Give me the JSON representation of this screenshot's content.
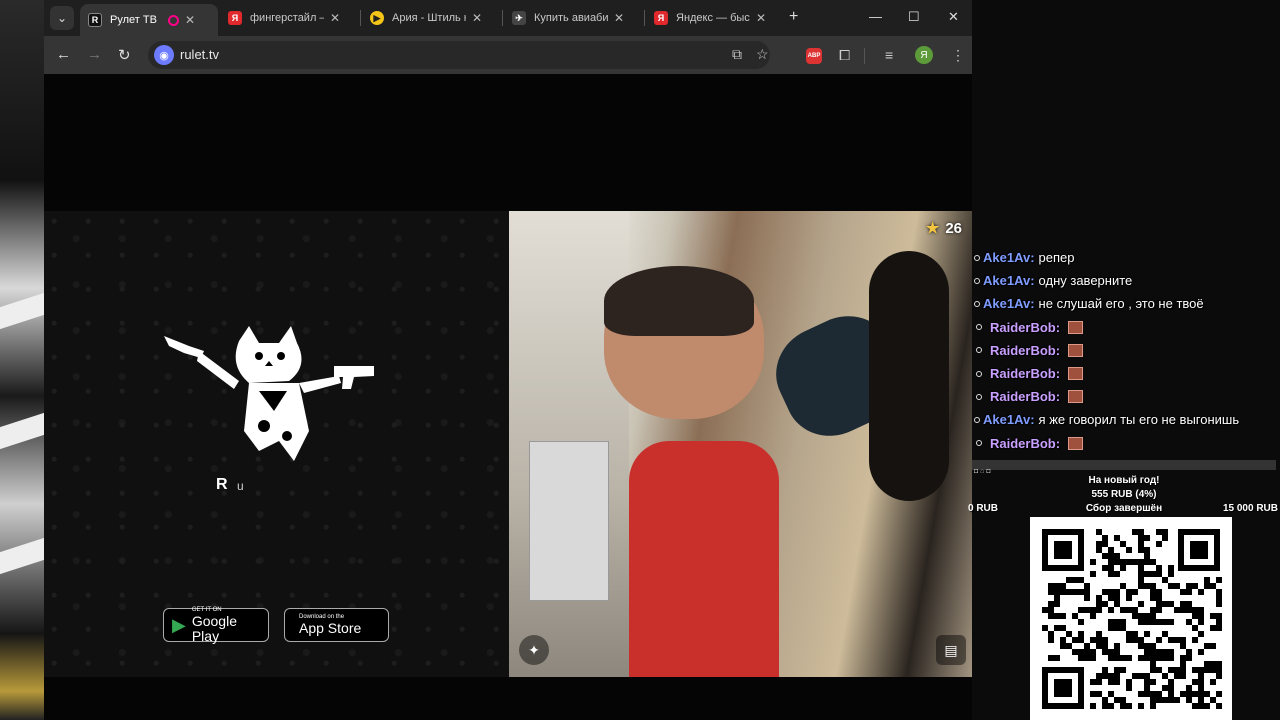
{
  "browser": {
    "tabs": [
      {
        "title": "Рулет ТВ",
        "favicon": "R",
        "favicon_color": "#111111",
        "active": true,
        "recording": true
      },
      {
        "title": "фингерстайл — Я",
        "favicon": "Я",
        "favicon_color": "#e0282d",
        "active": false
      },
      {
        "title": "Ария - Штиль на",
        "favicon": "▶",
        "favicon_color": "#f5c518",
        "active": false
      },
      {
        "title": "Купить авиабилет",
        "favicon": "✈",
        "favicon_color": "#444444",
        "active": false
      },
      {
        "title": "Яндекс — быстро",
        "favicon": "Я",
        "favicon_color": "#e0282d",
        "active": false
      }
    ],
    "url": "rulet.tv",
    "extension_abp": "ABP",
    "profile_initial": "Я"
  },
  "page": {
    "brand_letter": "R",
    "brand_rest": "u",
    "google_play": {
      "small": "GET IT ON",
      "big": "Google Play"
    },
    "app_store": {
      "small": "Download on the",
      "big": "App Store"
    },
    "star_count": "26"
  },
  "chat": {
    "messages": [
      {
        "user": "Ake1Av:",
        "text": "репер",
        "color": "#7f9cff",
        "emote": false
      },
      {
        "user": "Ake1Av:",
        "text": "одну заверните",
        "color": "#7f9cff",
        "emote": false
      },
      {
        "user": "Ake1Av:",
        "text": "не слушай его , это не твоё",
        "color": "#7f9cff",
        "emote": false
      },
      {
        "user": "RaiderBob:",
        "text": "",
        "color": "#c9a0ff",
        "emote": true
      },
      {
        "user": "RaiderBob:",
        "text": "",
        "color": "#c9a0ff",
        "emote": true
      },
      {
        "user": "RaiderBob:",
        "text": "",
        "color": "#c9a0ff",
        "emote": true
      },
      {
        "user": "RaiderBob:",
        "text": "",
        "color": "#c9a0ff",
        "emote": true
      },
      {
        "user": "Ake1Av:",
        "text": "я же говорил ты его не выгонишь",
        "color": "#7f9cff",
        "emote": false
      },
      {
        "user": "RaiderBob:",
        "text": "",
        "color": "#c9a0ff",
        "emote": true
      }
    ],
    "footer": "◘ ⌂ ◘"
  },
  "donation": {
    "title": "На новый год!",
    "amount": "555 RUB (4%)",
    "min": "0 RUB",
    "status": "Сбор завершён",
    "max": "15 000 RUB"
  },
  "colors": {
    "chrome_tabbar": "#1f1f1f",
    "chrome_toolbar": "#353535",
    "accent_star": "#f5c542"
  }
}
